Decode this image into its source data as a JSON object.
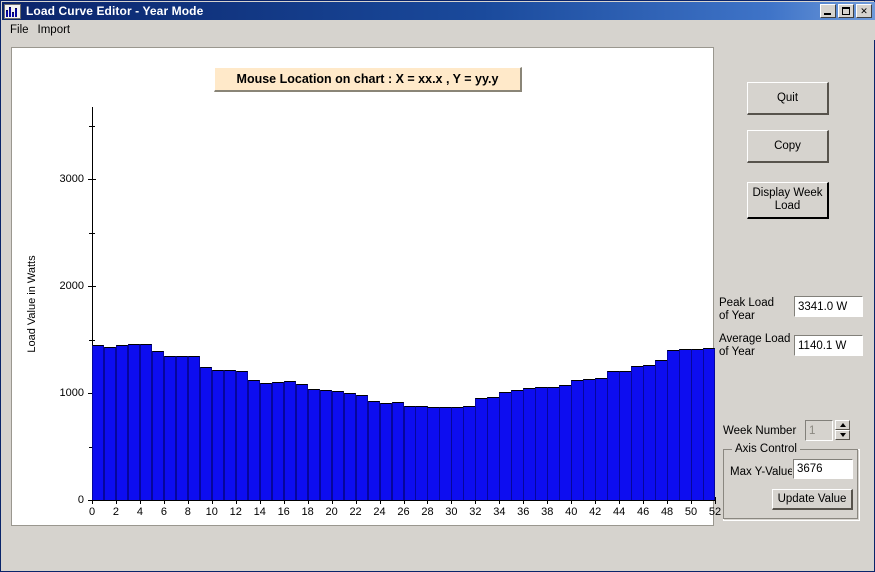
{
  "window": {
    "title": "Load Curve Editor - Year Mode",
    "icon": "app-chart-icon",
    "controls": {
      "minimize": "minimize-icon",
      "maximize": "maximize-icon",
      "close": "✕"
    }
  },
  "menu": {
    "items": [
      {
        "label": "File"
      },
      {
        "label": "Import"
      }
    ]
  },
  "chart_panel": {
    "mouse_location": "Mouse Location on chart : X = xx.x , Y = yy.y"
  },
  "side_panel": {
    "quit_label": "Quit",
    "copy_label": "Copy",
    "display_week_load_label": "Display Week\nLoad",
    "peak_load_label": "Peak Load\nof Year",
    "peak_load_value": "3341.0 W",
    "average_load_label": "Average Load\nof Year",
    "average_load_value": "1140.1 W",
    "week_number_label": "Week Number",
    "week_number_value": "1",
    "axis_control_title": "Axis Control",
    "max_y_label": "Max Y-Value",
    "max_y_value": "3676",
    "update_value_label": "Update Value"
  },
  "colors": {
    "title_bar_start": "#0a246a",
    "title_bar_end": "#6f9ada",
    "face": "#d6d3ce",
    "bar_fill": "#0d0df0",
    "bar_edge": "#06069c",
    "tooltip_bg": "#ffe9c9"
  },
  "chart_data": {
    "type": "bar",
    "title": "",
    "xlabel": "",
    "ylabel": "Load Value in Watts",
    "xlim": [
      0,
      52
    ],
    "ylim": [
      0,
      3676
    ],
    "grid": false,
    "legend": null,
    "y_ticks": [
      0,
      1000,
      2000,
      3000
    ],
    "y_tick_labels": [
      "0",
      "1000",
      "2000",
      "3000"
    ],
    "y_minor_ticks": [
      500,
      1500,
      2500,
      3500
    ],
    "x_ticks": [
      0,
      2,
      4,
      6,
      8,
      10,
      12,
      14,
      16,
      18,
      20,
      22,
      24,
      26,
      28,
      30,
      32,
      34,
      36,
      38,
      40,
      42,
      44,
      46,
      48,
      50,
      52
    ],
    "x_tick_labels": [
      "0",
      "2",
      "4",
      "6",
      "8",
      "10",
      "12",
      "14",
      "16",
      "18",
      "20",
      "22",
      "24",
      "26",
      "28",
      "30",
      "32",
      "34",
      "36",
      "38",
      "40",
      "42",
      "44",
      "46",
      "48",
      "50",
      "52"
    ],
    "categories": [
      1,
      2,
      3,
      4,
      5,
      6,
      7,
      8,
      9,
      10,
      11,
      12,
      13,
      14,
      15,
      16,
      17,
      18,
      19,
      20,
      21,
      22,
      23,
      24,
      25,
      26,
      27,
      28,
      29,
      30,
      31,
      32,
      33,
      34,
      35,
      36,
      37,
      38,
      39,
      40,
      41,
      42,
      43,
      44,
      45,
      46,
      47,
      48,
      49,
      50,
      51,
      52
    ],
    "values": [
      1450,
      1430,
      1450,
      1460,
      1455,
      1390,
      1350,
      1350,
      1345,
      1245,
      1220,
      1215,
      1205,
      1125,
      1090,
      1105,
      1110,
      1085,
      1040,
      1025,
      1020,
      1005,
      985,
      925,
      910,
      920,
      880,
      880,
      870,
      870,
      870,
      880,
      955,
      960,
      1010,
      1025,
      1050,
      1060,
      1060,
      1075,
      1125,
      1130,
      1145,
      1205,
      1210,
      1250,
      1265,
      1310,
      1400,
      1410,
      1415,
      1420
    ]
  }
}
